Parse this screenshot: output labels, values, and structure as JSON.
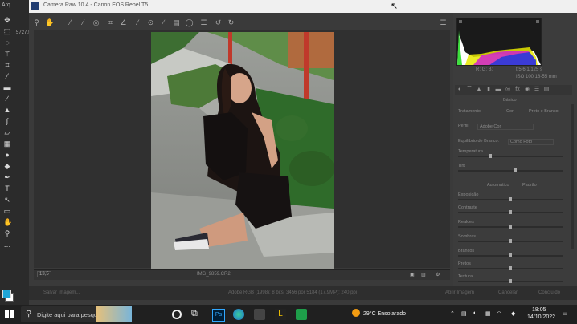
{
  "window": {
    "app_strip": "Arq",
    "title": "Camera Raw 10.4  -  Canon EOS Rebel T5",
    "side_strip": "5727.!"
  },
  "icons": {
    "ps_tools": [
      "move-icon",
      "marquee-icon",
      "lasso-icon",
      "magic-wand-icon",
      "crop-icon",
      "eyedropper-icon",
      "healing-icon",
      "brush-icon",
      "stamp-icon",
      "history-brush-icon",
      "eraser-icon",
      "gradient-icon",
      "blur-icon",
      "dodge-icon",
      "pen-icon",
      "type-icon",
      "path-selection-icon",
      "shape-icon",
      "hand-icon",
      "zoom-icon",
      "more-icon"
    ],
    "cr_tools": [
      "zoom-icon",
      "hand-icon",
      "white-balance-icon",
      "color-sampler-icon",
      "targeted-adjust-icon",
      "crop-icon",
      "straighten-icon",
      "spot-removal-icon",
      "red-eye-icon",
      "adjustment-brush-icon",
      "graduated-filter-icon",
      "radial-filter-icon",
      "preferences-icon",
      "rotate-left-icon",
      "rotate-right-icon"
    ]
  },
  "zoombar": {
    "zoom": "13,5",
    "filename": "IMG_9859.CR2"
  },
  "actionbar": {
    "save": "Salvar Imagem...",
    "info": "Adobe RGB (1998); 8 bits; 3456 por 5184 (17,9MP); 240 ppi",
    "open": "Abrir Imagem",
    "cancel": "Cancelar",
    "done": "Concluído"
  },
  "histogram": {
    "readout": [
      "R: G: B:",
      "f/5,6  1/125 s",
      "ISO 100  18-55 mm"
    ]
  },
  "panel": {
    "title": "Básico",
    "tratamento": {
      "label": "Tratamento:",
      "opt1": "Cor",
      "opt2": "Preto e Branco"
    },
    "perfil": {
      "label": "Perfil:",
      "value": "Adobe Cor"
    },
    "wb": {
      "label": "Equilíbrio de Branco:",
      "value": "Como Foto"
    },
    "sliders": [
      {
        "label": "Temperatura",
        "value": "",
        "pos": 0.3
      },
      {
        "label": "Tint",
        "value": "",
        "pos": 0.55
      },
      {
        "label": "Exposição",
        "value": "",
        "pos": 0.5
      },
      {
        "label": "Contraste",
        "value": "",
        "pos": 0.5
      },
      {
        "label": "Realces",
        "value": "",
        "pos": 0.5
      },
      {
        "label": "Sombras",
        "value": "",
        "pos": 0.5
      },
      {
        "label": "Brancos",
        "value": "",
        "pos": 0.5
      },
      {
        "label": "Pretos",
        "value": "",
        "pos": 0.5
      },
      {
        "label": "Textura",
        "value": "",
        "pos": 0.5
      }
    ],
    "auto": "Automático",
    "default": "Padrão"
  },
  "taskbar": {
    "search_placeholder": "Digite aqui para pesquisar",
    "weather": "29°C  Ensolarado",
    "time": "18:05",
    "date": "14/10/2022"
  },
  "colors": {
    "foreground": "#1ea5d6",
    "background": "#ffffff"
  }
}
